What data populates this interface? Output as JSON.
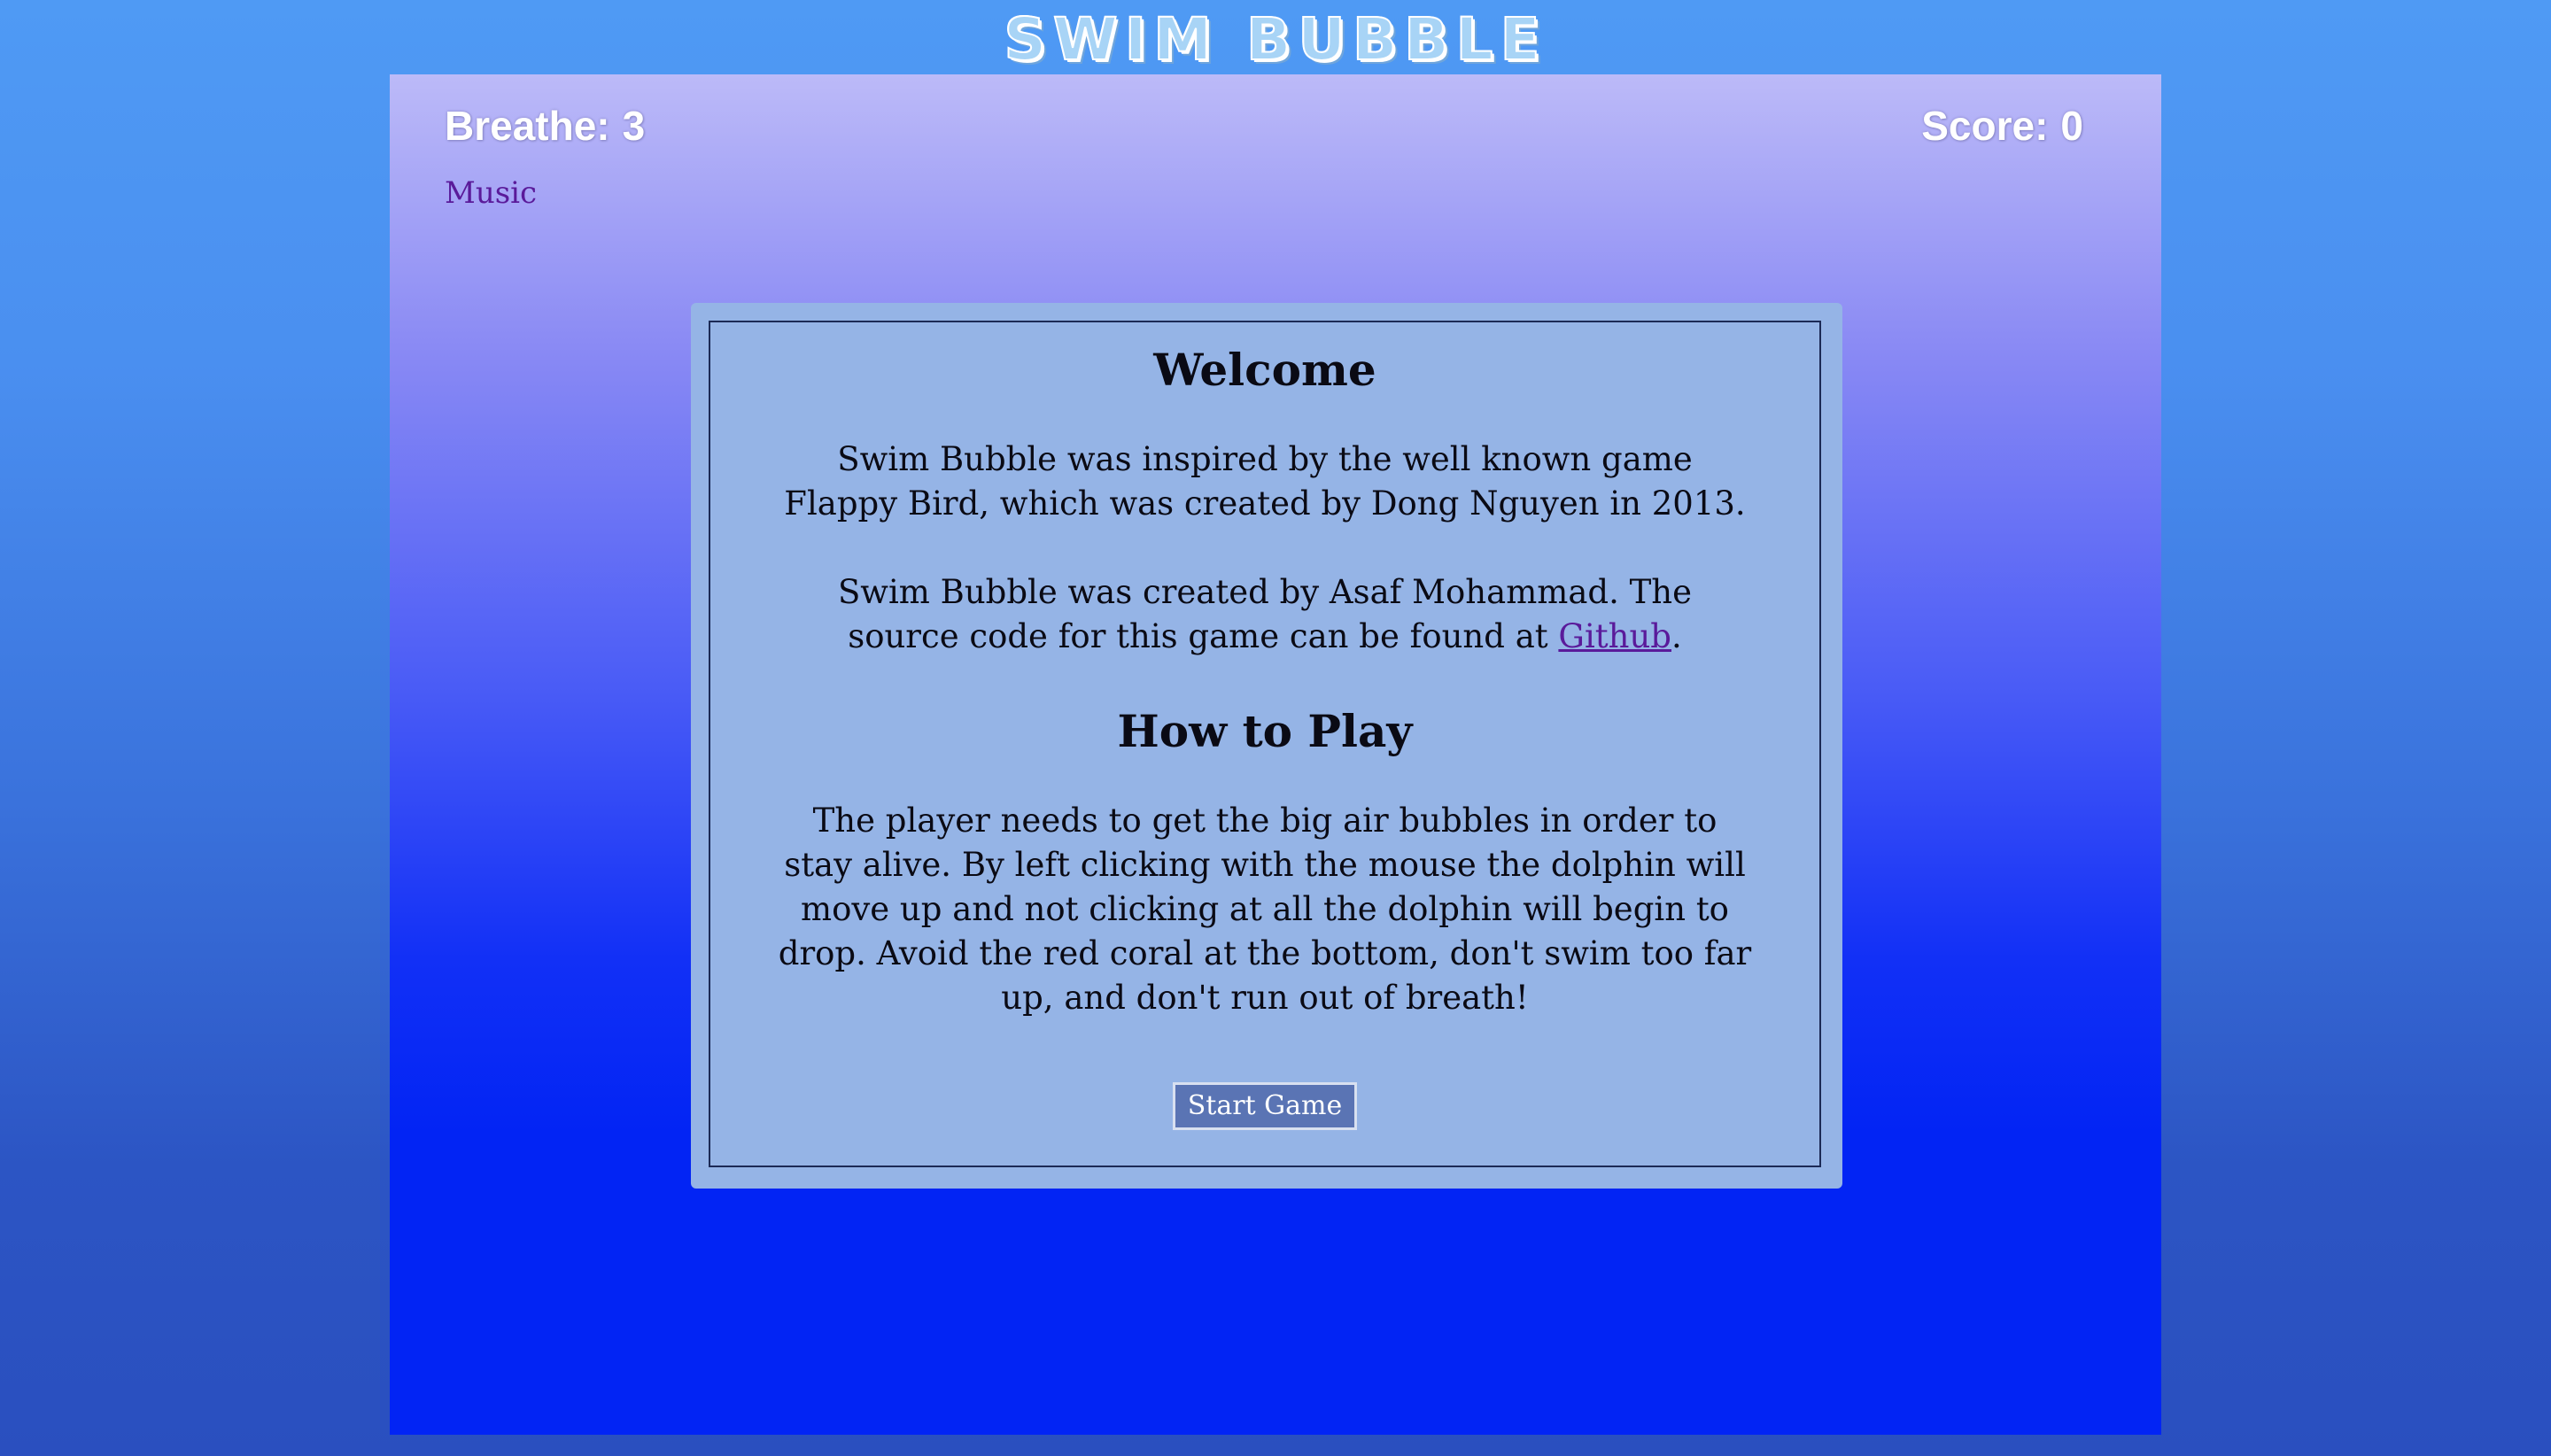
{
  "game_title": "SWIM BUBBLE",
  "hud": {
    "breathe_label": "Breathe:",
    "breathe_value": "3",
    "score_label": "Score:",
    "score_value": "0"
  },
  "music_link": "Music",
  "modal": {
    "welcome_heading": "Welcome",
    "intro_paragraph": "Swim Bubble was inspired by the well known game Flappy Bird, which was created by Dong Nguyen in 2013.",
    "credits_before_link": "Swim Bubble was created by Asaf Mohammad. The source code for this game can be found at ",
    "credits_link": "Github",
    "credits_after_link": ".",
    "howto_heading": "How to Play",
    "howto_paragraph": "The player needs to get the big air bubbles in order to stay alive. By left clicking with the mouse the dolphin will move up and not clicking at all the dolphin will begin to drop. Avoid the red coral at the bottom, don't swim too far up, and don't run out of breath!",
    "start_button": "Start Game"
  },
  "colors": {
    "page_background": "#4a8ff0",
    "game_sky_top": "#bcbaf8",
    "game_water_bottom": "#0224f4",
    "modal_background": "#95b4e6",
    "link_color": "#5a1a9a",
    "button_background": "#5a74b4"
  }
}
